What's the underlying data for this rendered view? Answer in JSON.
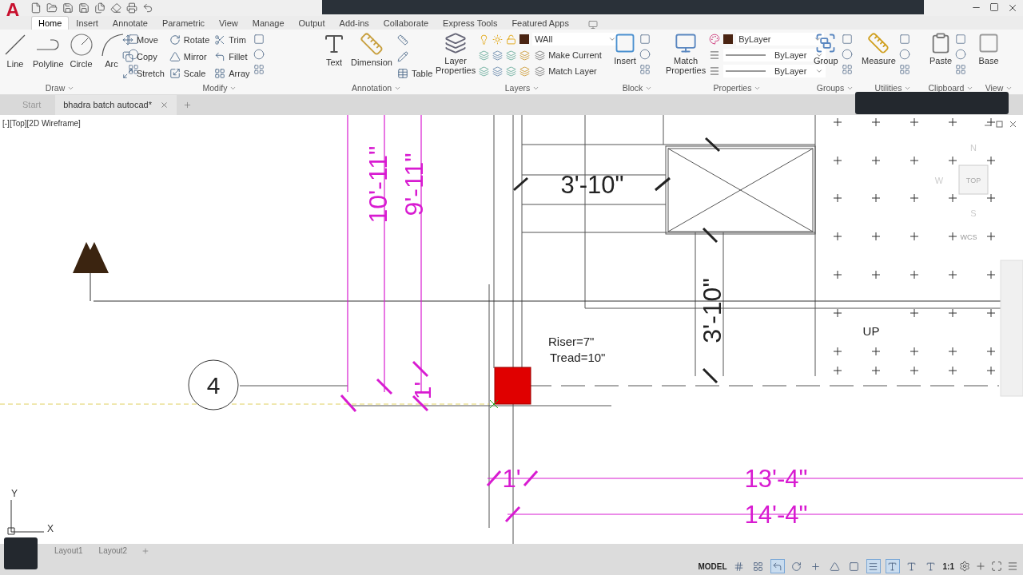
{
  "app_logo": "A",
  "ribbon_tabs": [
    {
      "label": "Home",
      "selected": true
    },
    {
      "label": "Insert",
      "selected": false
    },
    {
      "label": "Annotate",
      "selected": false
    },
    {
      "label": "Parametric",
      "selected": false
    },
    {
      "label": "View",
      "selected": false
    },
    {
      "label": "Manage",
      "selected": false
    },
    {
      "label": "Output",
      "selected": false
    },
    {
      "label": "Add-ins",
      "selected": false
    },
    {
      "label": "Collaborate",
      "selected": false
    },
    {
      "label": "Express Tools",
      "selected": false
    },
    {
      "label": "Featured Apps",
      "selected": false
    }
  ],
  "panels": [
    {
      "title": "Draw",
      "groups": [
        {
          "kind": "large",
          "label": "Line"
        },
        {
          "kind": "large",
          "label": "Polyline"
        },
        {
          "kind": "large",
          "label": "Circle"
        },
        {
          "kind": "large",
          "label": "Arc"
        },
        {
          "kind": "icon_column"
        }
      ]
    },
    {
      "title": "Modify",
      "groups": [
        {
          "kind": "stack",
          "items": [
            {
              "kind": "tool",
              "label": "Move"
            },
            {
              "kind": "tool",
              "label": "Copy"
            },
            {
              "kind": "tool",
              "label": "Stretch"
            }
          ]
        },
        {
          "kind": "stack",
          "items": [
            {
              "kind": "tool",
              "label": "Rotate"
            },
            {
              "kind": "tool",
              "label": "Mirror"
            },
            {
              "kind": "tool",
              "label": "Scale"
            }
          ]
        },
        {
          "kind": "stack",
          "items": [
            {
              "kind": "tool",
              "label": "Trim"
            },
            {
              "kind": "tool",
              "label": "Fillet"
            },
            {
              "kind": "tool",
              "label": "Array"
            }
          ]
        },
        {
          "kind": "icon_column"
        }
      ]
    },
    {
      "title": "Annotation",
      "groups": [
        {
          "kind": "large",
          "label": "Text"
        },
        {
          "kind": "large",
          "label": "Dimension"
        },
        {
          "kind": "stack",
          "items": [
            {
              "kind": "icon"
            },
            {
              "kind": "icon"
            },
            {
              "kind": "tool",
              "label": "Table"
            }
          ]
        }
      ]
    },
    {
      "title": "Layers",
      "groups": [
        {
          "kind": "large",
          "label": "Layer Properties"
        },
        {
          "kind": "stack",
          "items": [
            {
              "kind": "layer_combo",
              "value": "WAll"
            },
            {
              "kind": "layer_tool",
              "label": "Make Current"
            },
            {
              "kind": "layer_tool",
              "label": "Match Layer"
            }
          ]
        }
      ]
    },
    {
      "title": "Block",
      "groups": [
        {
          "kind": "large",
          "label": "Insert"
        },
        {
          "kind": "icon_column"
        }
      ]
    },
    {
      "title": "Properties",
      "groups": [
        {
          "kind": "large",
          "label": "Match Properties"
        },
        {
          "kind": "stack",
          "items": [
            {
              "kind": "color_combo",
              "value": "ByLayer"
            },
            {
              "kind": "line_combo",
              "value": "ByLayer"
            },
            {
              "kind": "line_combo",
              "value": "ByLayer"
            }
          ]
        }
      ]
    },
    {
      "title": "Groups",
      "groups": [
        {
          "kind": "large",
          "label": "Group"
        },
        {
          "kind": "icon_column"
        }
      ]
    },
    {
      "title": "Utilities",
      "groups": [
        {
          "kind": "large",
          "label": "Measure"
        },
        {
          "kind": "icon_column"
        }
      ]
    },
    {
      "title": "Clipboard",
      "groups": [
        {
          "kind": "large",
          "label": "Paste"
        },
        {
          "kind": "icon_column"
        }
      ]
    },
    {
      "title": "View",
      "groups": [
        {
          "kind": "large",
          "label": "Base"
        }
      ]
    }
  ],
  "file_tabs": [
    {
      "label": "Start",
      "selected": false,
      "closable": false
    },
    {
      "label": "bhadra batch autocad*",
      "selected": true,
      "closable": true
    }
  ],
  "viewport": {
    "label": "[-][Top][2D Wireframe]",
    "annotations": [
      {
        "kind": "vertical",
        "text": "10'-11\"",
        "color": "#d81bd1"
      },
      {
        "kind": "vertical",
        "text": "9'-11\"",
        "color": "#d81bd1"
      },
      {
        "kind": "horizontal",
        "text": "3'-10\"",
        "color": "#222222"
      },
      {
        "kind": "vertical",
        "text": "3'-10\"",
        "color": "#222222"
      },
      {
        "kind": "note",
        "text": "UP",
        "color": "#222222"
      },
      {
        "kind": "note",
        "text": "Riser=7\"",
        "color": "#222222"
      },
      {
        "kind": "note",
        "text": "Tread=10\"",
        "color": "#222222"
      },
      {
        "kind": "vertical",
        "text": "1'",
        "color": "#d81bd1"
      },
      {
        "kind": "horizontal",
        "text": "1'",
        "color": "#d81bd1"
      },
      {
        "kind": "horizontal",
        "text": "13'-4\"",
        "color": "#d81bd1"
      },
      {
        "kind": "horizontal",
        "text": "14'-4\"",
        "color": "#d81bd1"
      }
    ],
    "grid_bubble": "4",
    "viewcube": {
      "north": "N",
      "west": "W",
      "top": "TOP",
      "south": "S",
      "wcs": "WCS"
    },
    "ucs": {
      "y": "Y",
      "x": "X"
    }
  },
  "layout_tabs": [
    {
      "label": "Layout1",
      "selected": false
    },
    {
      "label": "Layout2",
      "selected": false
    }
  ],
  "status_bar": {
    "mode": "MODEL",
    "scale": "1:1",
    "toggles": [
      {
        "kind": "grid",
        "on": false
      },
      {
        "kind": "snap",
        "on": false
      },
      {
        "kind": "ortho",
        "on": true
      },
      {
        "kind": "polar",
        "on": false
      },
      {
        "kind": "tracking",
        "on": false
      },
      {
        "kind": "angle",
        "on": false
      },
      {
        "kind": "selection",
        "on": false
      },
      {
        "kind": "lineweight",
        "on": true
      },
      {
        "kind": "annotation",
        "on": true
      },
      {
        "kind": "autoscale",
        "on": false
      },
      {
        "kind": "annoscale",
        "on": false
      }
    ]
  }
}
